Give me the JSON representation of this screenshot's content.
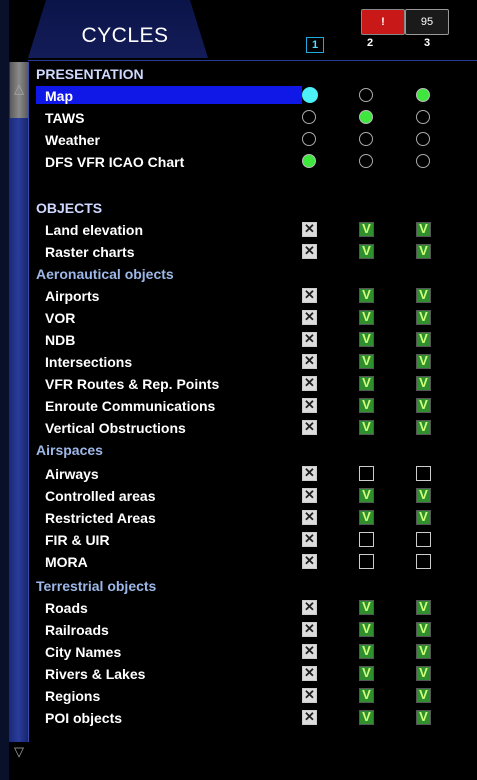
{
  "title": "CYCLES",
  "status_icons": {
    "warning": "!",
    "battery_percent": "95"
  },
  "columns": [
    "1",
    "2",
    "3"
  ],
  "scroll": {
    "up": "△",
    "down": "▽"
  },
  "rows": [
    {
      "type": "sect",
      "label": "PRESENTATION"
    },
    {
      "type": "radio",
      "label": "Map",
      "selected": true,
      "states": [
        "cyan",
        "off",
        "on"
      ]
    },
    {
      "type": "radio",
      "label": "TAWS",
      "states": [
        "off",
        "on",
        "off"
      ]
    },
    {
      "type": "radio",
      "label": "Weather",
      "states": [
        "off",
        "off",
        "off"
      ]
    },
    {
      "type": "radio",
      "label": "DFS VFR ICAO Chart",
      "states": [
        "on",
        "off",
        "off"
      ]
    },
    {
      "type": "blank"
    },
    {
      "type": "sect",
      "label": "OBJECTS"
    },
    {
      "type": "check",
      "label": "Land elevation",
      "states": [
        "x",
        "v",
        "v"
      ]
    },
    {
      "type": "check",
      "label": "Raster charts",
      "states": [
        "x",
        "v",
        "v"
      ]
    },
    {
      "type": "sub",
      "label": "Aeronautical objects"
    },
    {
      "type": "check",
      "label": "Airports",
      "states": [
        "x",
        "v",
        "v"
      ]
    },
    {
      "type": "check",
      "label": "VOR",
      "states": [
        "x",
        "v",
        "v"
      ]
    },
    {
      "type": "check",
      "label": "NDB",
      "states": [
        "x",
        "v",
        "v"
      ]
    },
    {
      "type": "check",
      "label": "Intersections",
      "states": [
        "x",
        "v",
        "v"
      ]
    },
    {
      "type": "check",
      "label": "VFR Routes & Rep. Points",
      "states": [
        "x",
        "v",
        "v"
      ]
    },
    {
      "type": "check",
      "label": "Enroute Communications",
      "states": [
        "x",
        "v",
        "v"
      ]
    },
    {
      "type": "check",
      "label": "Vertical Obstructions",
      "states": [
        "x",
        "v",
        "v"
      ]
    },
    {
      "type": "sub",
      "label": "Airspaces"
    },
    {
      "type": "check",
      "label": "Airways",
      "states": [
        "x",
        "e",
        "e"
      ]
    },
    {
      "type": "check",
      "label": "Controlled areas",
      "states": [
        "x",
        "v",
        "v"
      ]
    },
    {
      "type": "check",
      "label": "Restricted Areas",
      "states": [
        "x",
        "v",
        "v"
      ]
    },
    {
      "type": "check",
      "label": "FIR & UIR",
      "states": [
        "x",
        "e",
        "e"
      ]
    },
    {
      "type": "check",
      "label": "MORA",
      "states": [
        "x",
        "e",
        "e"
      ]
    },
    {
      "type": "sub",
      "label": "Terrestrial objects"
    },
    {
      "type": "check",
      "label": "Roads",
      "states": [
        "x",
        "v",
        "v"
      ]
    },
    {
      "type": "check",
      "label": "Railroads",
      "states": [
        "x",
        "v",
        "v"
      ]
    },
    {
      "type": "check",
      "label": "City Names",
      "states": [
        "x",
        "v",
        "v"
      ]
    },
    {
      "type": "check",
      "label": "Rivers & Lakes",
      "states": [
        "x",
        "v",
        "v"
      ]
    },
    {
      "type": "check",
      "label": "Regions",
      "states": [
        "x",
        "v",
        "v"
      ]
    },
    {
      "type": "check",
      "label": "POI objects",
      "states": [
        "x",
        "v",
        "v"
      ]
    }
  ],
  "glyphs": {
    "x": "✕",
    "v": "V"
  }
}
